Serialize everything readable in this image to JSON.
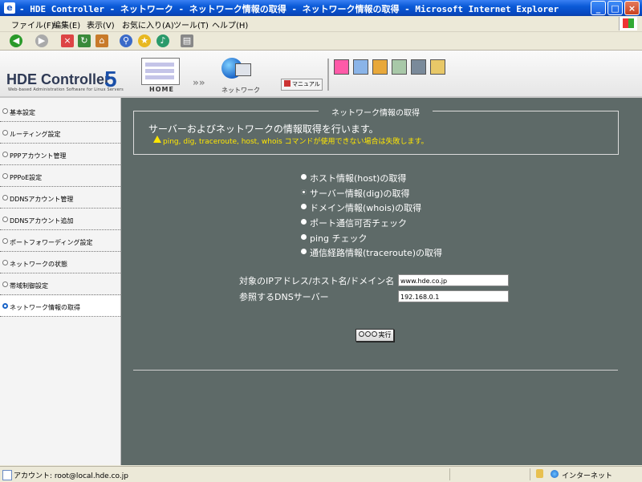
{
  "window": {
    "title": "- HDE Controller - ネットワーク - ネットワーク情報の取得 - ネットワーク情報の取得 - Microsoft Internet Explorer",
    "controls": [
      "_",
      "□",
      "×"
    ]
  },
  "menu": [
    "ファイル(F)",
    "編集(E)",
    "表示(V)",
    "お気に入り(A)",
    "ツール(T)",
    "ヘルプ(H)"
  ],
  "toolbar": {
    "icons": [
      "back-icon",
      "forward-icon",
      "stop-icon",
      "refresh-icon",
      "home-icon",
      "search-icon",
      "favorites-icon",
      "media-icon",
      "print-icon"
    ]
  },
  "header": {
    "logo": "HDE Controller",
    "version": "5",
    "logo_sub": "Web-based Administration Software for Linux Servers",
    "home_label": "HOME",
    "arrows": "»»",
    "network_label": "ネットワーク",
    "manual_label": "マニュアル"
  },
  "sidebar": {
    "items": [
      {
        "label": "基本設定",
        "active": false
      },
      {
        "label": "ルーティング設定",
        "active": false
      },
      {
        "label": "PPPアカウント管理",
        "active": false
      },
      {
        "label": "PPPoE設定",
        "active": false
      },
      {
        "label": "DDNSアカウント管理",
        "active": false
      },
      {
        "label": "DDNSアカウント追加",
        "active": false
      },
      {
        "label": "ポートフォワーディング設定",
        "active": false
      },
      {
        "label": "ネットワークの状態",
        "active": false
      },
      {
        "label": "帯域制御設定",
        "active": false
      },
      {
        "label": "ネットワーク情報の取得",
        "active": true
      }
    ]
  },
  "main": {
    "legend": "ネットワーク情報の取得",
    "description": "サーバーおよびネットワークの情報取得を行います。",
    "warning": "ping, dig, traceroute, host, whois コマンドが使用できない場合は失敗します。",
    "options": [
      {
        "label": "ホスト情報(host)の取得",
        "selected": false
      },
      {
        "label": "サーバー情報(dig)の取得",
        "selected": true
      },
      {
        "label": "ドメイン情報(whois)の取得",
        "selected": false
      },
      {
        "label": "ポート通信可否チェック",
        "selected": false
      },
      {
        "label": "ping チェック",
        "selected": false
      },
      {
        "label": "通信経路情報(traceroute)の取得",
        "selected": false
      }
    ],
    "target_label": "対象のIPアドレス/ホスト名/ドメイン名",
    "target_value": "www.hde.co.jp",
    "dns_label": "参照するDNSサーバー",
    "dns_value": "192.168.0.1",
    "execute_label": "実行"
  },
  "status": {
    "left": "アカウント: root@local.hde.co.jp",
    "zone": "インターネット"
  }
}
